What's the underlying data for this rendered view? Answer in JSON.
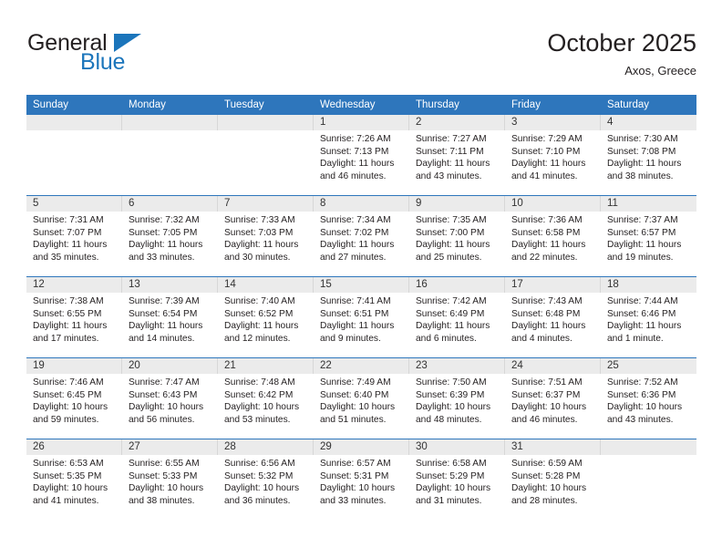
{
  "brand": {
    "name_top": "General",
    "name_bottom": "Blue",
    "accent_color": "#1b75bb",
    "top_text_color": "#231f20"
  },
  "header": {
    "month_title": "October 2025",
    "location": "Axos, Greece"
  },
  "theme": {
    "header_blue": "#2e76bc",
    "daynum_band": "#ebebeb",
    "text": "#231f20",
    "page_background": "#ffffff"
  },
  "calendar": {
    "weekday_headers": [
      "Sunday",
      "Monday",
      "Tuesday",
      "Wednesday",
      "Thursday",
      "Friday",
      "Saturday"
    ],
    "weeks": [
      [
        {
          "day": "",
          "sunrise": "",
          "sunset": "",
          "daylight_line1": "",
          "daylight_line2": "",
          "empty": true
        },
        {
          "day": "",
          "sunrise": "",
          "sunset": "",
          "daylight_line1": "",
          "daylight_line2": "",
          "empty": true
        },
        {
          "day": "",
          "sunrise": "",
          "sunset": "",
          "daylight_line1": "",
          "daylight_line2": "",
          "empty": true
        },
        {
          "day": "1",
          "sunrise": "Sunrise: 7:26 AM",
          "sunset": "Sunset: 7:13 PM",
          "daylight_line1": "Daylight: 11 hours",
          "daylight_line2": "and 46 minutes.",
          "empty": false
        },
        {
          "day": "2",
          "sunrise": "Sunrise: 7:27 AM",
          "sunset": "Sunset: 7:11 PM",
          "daylight_line1": "Daylight: 11 hours",
          "daylight_line2": "and 43 minutes.",
          "empty": false
        },
        {
          "day": "3",
          "sunrise": "Sunrise: 7:29 AM",
          "sunset": "Sunset: 7:10 PM",
          "daylight_line1": "Daylight: 11 hours",
          "daylight_line2": "and 41 minutes.",
          "empty": false
        },
        {
          "day": "4",
          "sunrise": "Sunrise: 7:30 AM",
          "sunset": "Sunset: 7:08 PM",
          "daylight_line1": "Daylight: 11 hours",
          "daylight_line2": "and 38 minutes.",
          "empty": false
        }
      ],
      [
        {
          "day": "5",
          "sunrise": "Sunrise: 7:31 AM",
          "sunset": "Sunset: 7:07 PM",
          "daylight_line1": "Daylight: 11 hours",
          "daylight_line2": "and 35 minutes.",
          "empty": false
        },
        {
          "day": "6",
          "sunrise": "Sunrise: 7:32 AM",
          "sunset": "Sunset: 7:05 PM",
          "daylight_line1": "Daylight: 11 hours",
          "daylight_line2": "and 33 minutes.",
          "empty": false
        },
        {
          "day": "7",
          "sunrise": "Sunrise: 7:33 AM",
          "sunset": "Sunset: 7:03 PM",
          "daylight_line1": "Daylight: 11 hours",
          "daylight_line2": "and 30 minutes.",
          "empty": false
        },
        {
          "day": "8",
          "sunrise": "Sunrise: 7:34 AM",
          "sunset": "Sunset: 7:02 PM",
          "daylight_line1": "Daylight: 11 hours",
          "daylight_line2": "and 27 minutes.",
          "empty": false
        },
        {
          "day": "9",
          "sunrise": "Sunrise: 7:35 AM",
          "sunset": "Sunset: 7:00 PM",
          "daylight_line1": "Daylight: 11 hours",
          "daylight_line2": "and 25 minutes.",
          "empty": false
        },
        {
          "day": "10",
          "sunrise": "Sunrise: 7:36 AM",
          "sunset": "Sunset: 6:58 PM",
          "daylight_line1": "Daylight: 11 hours",
          "daylight_line2": "and 22 minutes.",
          "empty": false
        },
        {
          "day": "11",
          "sunrise": "Sunrise: 7:37 AM",
          "sunset": "Sunset: 6:57 PM",
          "daylight_line1": "Daylight: 11 hours",
          "daylight_line2": "and 19 minutes.",
          "empty": false
        }
      ],
      [
        {
          "day": "12",
          "sunrise": "Sunrise: 7:38 AM",
          "sunset": "Sunset: 6:55 PM",
          "daylight_line1": "Daylight: 11 hours",
          "daylight_line2": "and 17 minutes.",
          "empty": false
        },
        {
          "day": "13",
          "sunrise": "Sunrise: 7:39 AM",
          "sunset": "Sunset: 6:54 PM",
          "daylight_line1": "Daylight: 11 hours",
          "daylight_line2": "and 14 minutes.",
          "empty": false
        },
        {
          "day": "14",
          "sunrise": "Sunrise: 7:40 AM",
          "sunset": "Sunset: 6:52 PM",
          "daylight_line1": "Daylight: 11 hours",
          "daylight_line2": "and 12 minutes.",
          "empty": false
        },
        {
          "day": "15",
          "sunrise": "Sunrise: 7:41 AM",
          "sunset": "Sunset: 6:51 PM",
          "daylight_line1": "Daylight: 11 hours",
          "daylight_line2": "and 9 minutes.",
          "empty": false
        },
        {
          "day": "16",
          "sunrise": "Sunrise: 7:42 AM",
          "sunset": "Sunset: 6:49 PM",
          "daylight_line1": "Daylight: 11 hours",
          "daylight_line2": "and 6 minutes.",
          "empty": false
        },
        {
          "day": "17",
          "sunrise": "Sunrise: 7:43 AM",
          "sunset": "Sunset: 6:48 PM",
          "daylight_line1": "Daylight: 11 hours",
          "daylight_line2": "and 4 minutes.",
          "empty": false
        },
        {
          "day": "18",
          "sunrise": "Sunrise: 7:44 AM",
          "sunset": "Sunset: 6:46 PM",
          "daylight_line1": "Daylight: 11 hours",
          "daylight_line2": "and 1 minute.",
          "empty": false
        }
      ],
      [
        {
          "day": "19",
          "sunrise": "Sunrise: 7:46 AM",
          "sunset": "Sunset: 6:45 PM",
          "daylight_line1": "Daylight: 10 hours",
          "daylight_line2": "and 59 minutes.",
          "empty": false
        },
        {
          "day": "20",
          "sunrise": "Sunrise: 7:47 AM",
          "sunset": "Sunset: 6:43 PM",
          "daylight_line1": "Daylight: 10 hours",
          "daylight_line2": "and 56 minutes.",
          "empty": false
        },
        {
          "day": "21",
          "sunrise": "Sunrise: 7:48 AM",
          "sunset": "Sunset: 6:42 PM",
          "daylight_line1": "Daylight: 10 hours",
          "daylight_line2": "and 53 minutes.",
          "empty": false
        },
        {
          "day": "22",
          "sunrise": "Sunrise: 7:49 AM",
          "sunset": "Sunset: 6:40 PM",
          "daylight_line1": "Daylight: 10 hours",
          "daylight_line2": "and 51 minutes.",
          "empty": false
        },
        {
          "day": "23",
          "sunrise": "Sunrise: 7:50 AM",
          "sunset": "Sunset: 6:39 PM",
          "daylight_line1": "Daylight: 10 hours",
          "daylight_line2": "and 48 minutes.",
          "empty": false
        },
        {
          "day": "24",
          "sunrise": "Sunrise: 7:51 AM",
          "sunset": "Sunset: 6:37 PM",
          "daylight_line1": "Daylight: 10 hours",
          "daylight_line2": "and 46 minutes.",
          "empty": false
        },
        {
          "day": "25",
          "sunrise": "Sunrise: 7:52 AM",
          "sunset": "Sunset: 6:36 PM",
          "daylight_line1": "Daylight: 10 hours",
          "daylight_line2": "and 43 minutes.",
          "empty": false
        }
      ],
      [
        {
          "day": "26",
          "sunrise": "Sunrise: 6:53 AM",
          "sunset": "Sunset: 5:35 PM",
          "daylight_line1": "Daylight: 10 hours",
          "daylight_line2": "and 41 minutes.",
          "empty": false
        },
        {
          "day": "27",
          "sunrise": "Sunrise: 6:55 AM",
          "sunset": "Sunset: 5:33 PM",
          "daylight_line1": "Daylight: 10 hours",
          "daylight_line2": "and 38 minutes.",
          "empty": false
        },
        {
          "day": "28",
          "sunrise": "Sunrise: 6:56 AM",
          "sunset": "Sunset: 5:32 PM",
          "daylight_line1": "Daylight: 10 hours",
          "daylight_line2": "and 36 minutes.",
          "empty": false
        },
        {
          "day": "29",
          "sunrise": "Sunrise: 6:57 AM",
          "sunset": "Sunset: 5:31 PM",
          "daylight_line1": "Daylight: 10 hours",
          "daylight_line2": "and 33 minutes.",
          "empty": false
        },
        {
          "day": "30",
          "sunrise": "Sunrise: 6:58 AM",
          "sunset": "Sunset: 5:29 PM",
          "daylight_line1": "Daylight: 10 hours",
          "daylight_line2": "and 31 minutes.",
          "empty": false
        },
        {
          "day": "31",
          "sunrise": "Sunrise: 6:59 AM",
          "sunset": "Sunset: 5:28 PM",
          "daylight_line1": "Daylight: 10 hours",
          "daylight_line2": "and 28 minutes.",
          "empty": false
        },
        {
          "day": "",
          "sunrise": "",
          "sunset": "",
          "daylight_line1": "",
          "daylight_line2": "",
          "empty": true
        }
      ]
    ]
  }
}
